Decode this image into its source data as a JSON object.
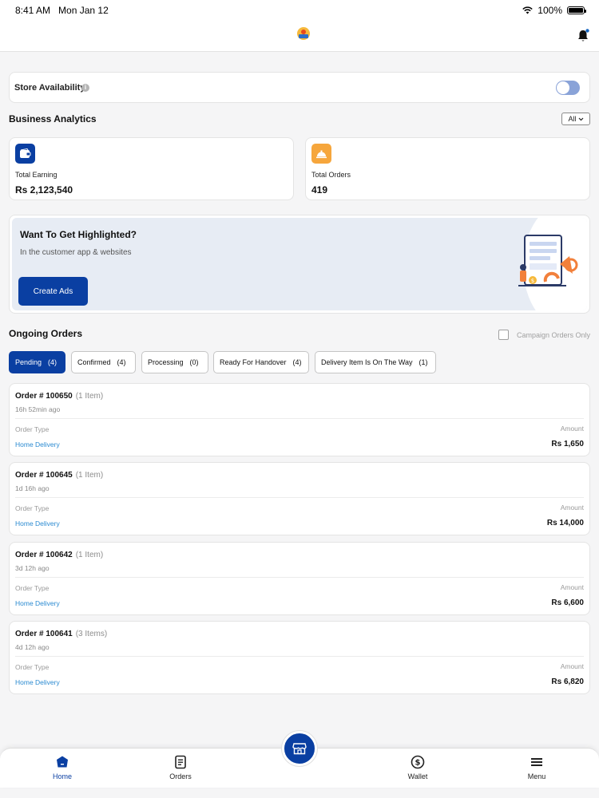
{
  "status_bar": {
    "time": "8:41 AM",
    "date": "Mon Jan 12",
    "battery": "100%"
  },
  "store": {
    "label": "Store Availability",
    "enabled": false
  },
  "analytics": {
    "title": "Business Analytics",
    "filter": "All",
    "earning": {
      "label": "Total Earning",
      "value": "Rs 2,123,540"
    },
    "orders": {
      "label": "Total Orders",
      "value": "419"
    }
  },
  "banner": {
    "title": "Want To Get Highlighted?",
    "subtitle": "In the customer app & websites",
    "button": "Create Ads"
  },
  "ongoing": {
    "title": "Ongoing Orders",
    "campaign_label": "Campaign Orders Only",
    "tabs": [
      {
        "label": "Pending",
        "count": "(4)"
      },
      {
        "label": "Confirmed",
        "count": "(4)"
      },
      {
        "label": "Processing",
        "count": "(0)"
      },
      {
        "label": "Ready For Handover",
        "count": "(4)"
      },
      {
        "label": "Delivery Item Is On The Way",
        "count": "(1)"
      }
    ]
  },
  "orders": [
    {
      "title": "Order # 100650",
      "items": "(1 Item)",
      "time": "16h 52min ago",
      "type_label": "Order Type",
      "type": "Home Delivery",
      "amount_label": "Amount",
      "amount": "Rs 1,650"
    },
    {
      "title": "Order # 100645",
      "items": "(1 Item)",
      "time": "1d 16h ago",
      "type_label": "Order Type",
      "type": "Home Delivery",
      "amount_label": "Amount",
      "amount": "Rs 14,000"
    },
    {
      "title": "Order # 100642",
      "items": "(1 Item)",
      "time": "3d 12h ago",
      "type_label": "Order Type",
      "type": "Home Delivery",
      "amount_label": "Amount",
      "amount": "Rs 6,600"
    },
    {
      "title": "Order # 100641",
      "items": "(3 Items)",
      "time": "4d 12h ago",
      "type_label": "Order Type",
      "type": "Home Delivery",
      "amount_label": "Amount",
      "amount": "Rs 6,820"
    }
  ],
  "nav": {
    "home": "Home",
    "orders": "Orders",
    "wallet": "Wallet",
    "menu": "Menu"
  },
  "colors": {
    "primary": "#0a3fa2",
    "accent_orange": "#f6a63c",
    "link": "#2a8ad1"
  }
}
